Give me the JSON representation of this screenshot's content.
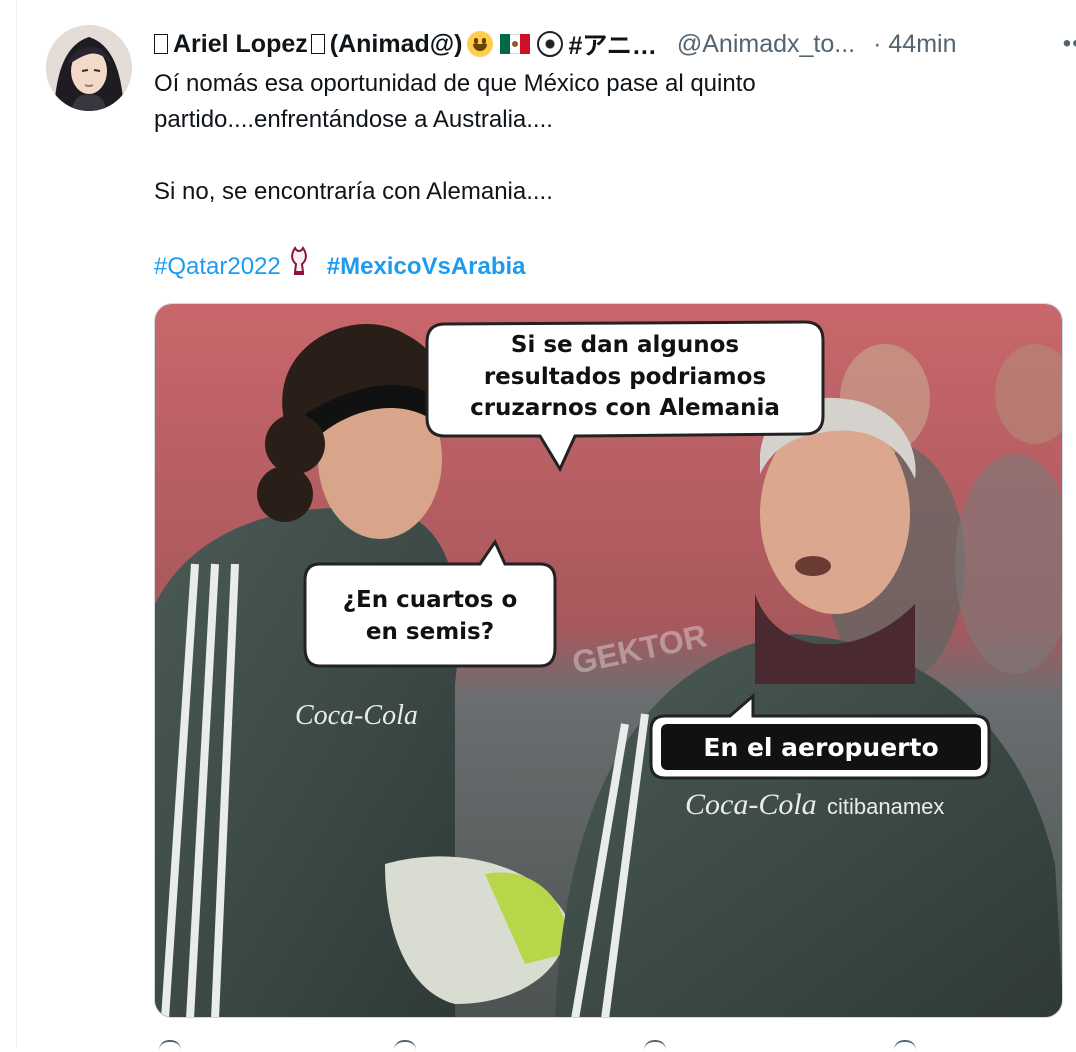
{
  "tweet": {
    "display_name": "Ariel Lopez",
    "display_name_suffix": "(Animad@)",
    "name_tail": "#アニ…",
    "handle": "@Animadx_to...",
    "time": "· 44min",
    "more": "•••",
    "text_lines": [
      "Oí nomás esa oportunidad de que México pase al quinto",
      "partido....enfrentándose a Australia....",
      "Si no, se encontraría con Alemania...."
    ],
    "hashtags": [
      {
        "label": "#Qatar2022",
        "bold": false
      },
      {
        "label": "#MexicoVsArabia",
        "bold": true
      }
    ]
  },
  "media": {
    "bubble_top_lines": [
      "Si se dan algunos",
      "resultados podriamos",
      "cruzarnos con Alemania"
    ],
    "bubble_left_lines": [
      "¿En cuartos o",
      "en semis?"
    ],
    "bubble_right": "En el aeropuerto",
    "watermark": "GEKTOR",
    "sponsor_left": "Coca-Cola",
    "sponsor_right_1": "Coca-Cola",
    "sponsor_right_2": "citibanamex"
  },
  "icons": {
    "avatar": "avatar-portrait",
    "more": "more-horizontal-icon",
    "trophy": "world-cup-trophy-icon",
    "smile": "grinning-face-emoji",
    "flag": "mexico-flag-emoji",
    "ball": "soccer-ball-emoji"
  }
}
